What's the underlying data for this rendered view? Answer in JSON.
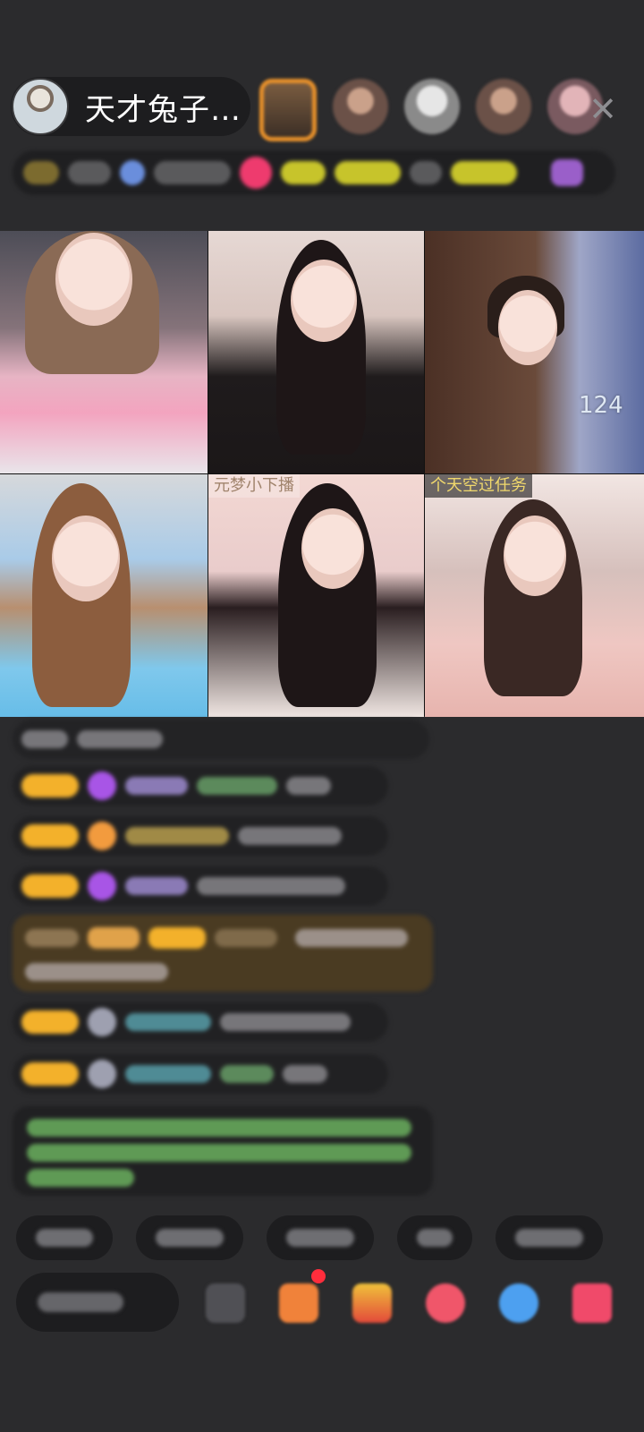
{
  "header": {
    "host_name": "天才兔子…",
    "close_icon": "close-icon"
  },
  "grid": {
    "tiles": [
      {
        "label": ""
      },
      {
        "label": ""
      },
      {
        "label": "",
        "count": "124"
      },
      {
        "label": ""
      },
      {
        "label": "元梦小下播"
      },
      {
        "label": "个天空过任务"
      }
    ]
  },
  "icons": {
    "viewers": "viewer-avatar-icon",
    "more": "more-icon"
  },
  "colors": {
    "background": "#2b2b2d",
    "badge": "#f3b12b",
    "pill": "#1d1d1f"
  }
}
